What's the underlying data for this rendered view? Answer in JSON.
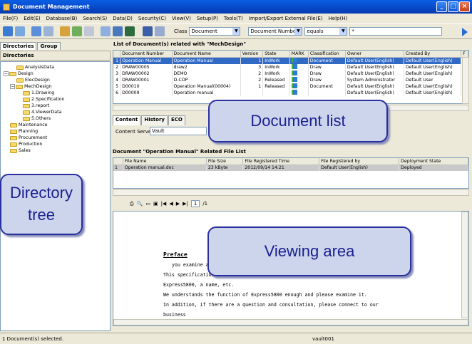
{
  "window": {
    "title": "Document Management"
  },
  "menu": [
    "File(F)",
    "Edit(E)",
    "Database(B)",
    "Search(S)",
    "Data(D)",
    "Security(C)",
    "View(V)",
    "Setup(P)",
    "Tools(T)",
    "Import/Export External File(E)",
    "Help(H)"
  ],
  "toolbar": {
    "class_label": "Class",
    "class_value": "Document",
    "field_value": "Document Number",
    "operator_value": "equals",
    "search_value": "*"
  },
  "left_tabs": [
    "Directories",
    "Group"
  ],
  "tree_header": "Directories",
  "tree": [
    {
      "label": "AnalysisData",
      "level": 1
    },
    {
      "label": "Design",
      "level": 0,
      "expander": "−"
    },
    {
      "label": "ElecDesign",
      "level": 1
    },
    {
      "label": "MechDesign",
      "level": 1,
      "expander": "−"
    },
    {
      "label": "1.Drawing",
      "level": 2
    },
    {
      "label": "2.Specification",
      "level": 2
    },
    {
      "label": "3.report",
      "level": 2
    },
    {
      "label": "4.ViewerData",
      "level": 2
    },
    {
      "label": "5.Others",
      "level": 2
    },
    {
      "label": "Maintenance",
      "level": 0
    },
    {
      "label": "Planning",
      "level": 0
    },
    {
      "label": "Procurement",
      "level": 0
    },
    {
      "label": "Production",
      "level": 0
    },
    {
      "label": "Sales",
      "level": 0
    }
  ],
  "doc_list_title": "List of Document(s) related with \"MechDesign\"",
  "doc_columns": [
    "",
    "Document Number",
    "Document Name",
    "Version",
    "State",
    "MARK",
    "Classification",
    "Owner",
    "Created By",
    "F"
  ],
  "doc_rows": [
    [
      "1",
      "Operation Manual",
      "Operation Manual",
      "1",
      "InWork",
      "",
      "Document",
      "Default User(English)",
      "Default User(English)"
    ],
    [
      "2",
      "DRAW00005",
      "draw2",
      "3",
      "InWork",
      "",
      "Draw",
      "Default User(English)",
      "Default User(English)"
    ],
    [
      "3",
      "DRAW00002",
      "DEMO",
      "2",
      "InWork",
      "",
      "Draw",
      "Default User(English)",
      "Default User(English)"
    ],
    [
      "4",
      "DRAW00001",
      "D-COP",
      "2",
      "Released",
      "",
      "Draw",
      "System Administrator",
      "Default User"
    ],
    [
      "5",
      "D00010",
      "Operation Manual(00004)",
      "1",
      "Released",
      "",
      "Document",
      "Default User(English)",
      "Default User(English)"
    ],
    [
      "6",
      "D00009",
      "Operation manual",
      "",
      "",
      "",
      "",
      "Default User(English)",
      "Default User(English)"
    ]
  ],
  "detail_tabs": [
    "Content",
    "History",
    "ECO"
  ],
  "content_server_label": "Content Server",
  "content_server_value": "Vault",
  "related_title": "Document \"Operation Manual\" Related File List",
  "file_columns": [
    "",
    "File Name",
    "File Size",
    "File Registered Time",
    "File Registered by",
    "Deployment State"
  ],
  "file_rows": [
    [
      "1",
      "Operation manual.doc",
      "23 kByte",
      "2012/09/14 14:21",
      "Default User(English)",
      "Deployed"
    ]
  ],
  "viewer_toolbar": {
    "page_value": "1",
    "page_total": "/1"
  },
  "viewer_doc": {
    "heading": "Preface",
    "lines": [
      "you examine ab",
      "This specification general information manual indicates the rough specification of",
      "Express5800, a name, etc.",
      "We understands the function of Express5800 enough and please examine it.",
      "In addition, if there are a question and consultation, please connect to our",
      "business"
    ]
  },
  "status": {
    "left": "1 Document(s) selected.",
    "vault": "vault001"
  },
  "callouts": {
    "document_list": "Document list",
    "directory_tree": "Directory\ntree",
    "viewing_area": "Viewing area"
  },
  "colors": {
    "title_bar": "#0a5ee3",
    "selected_row": "#316ac5",
    "callout_border": "#2a2fa0",
    "callout_fill": "#cdd5ec"
  }
}
